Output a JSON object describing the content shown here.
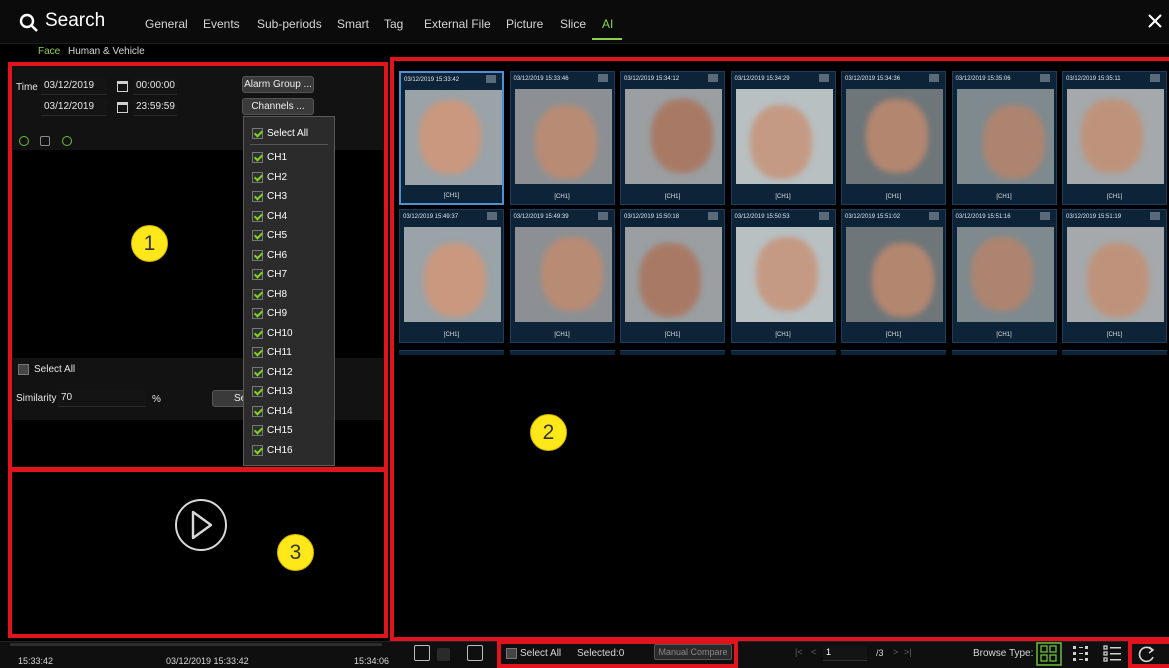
{
  "header": {
    "title": "Search",
    "tabs": [
      "General",
      "Events",
      "Sub-periods",
      "Smart",
      "Tag",
      "External File",
      "Picture",
      "Slice",
      "AI"
    ],
    "active_tab": "AI",
    "subtabs": [
      "Face",
      "Human & Vehicle"
    ],
    "active_subtab": "Face"
  },
  "filters": {
    "time_label": "Time",
    "start_date": "03/12/2019",
    "start_time": "00:00:00",
    "end_date": "03/12/2019",
    "end_time": "23:59:59",
    "alarm_group_btn": "Alarm Group ...",
    "channels_btn": "Channels ...",
    "select_all": "Select All",
    "similarity_label": "Similarity",
    "similarity_value": "70",
    "similarity_unit": "%",
    "search_btn_partial": "Se"
  },
  "channel_dropdown": {
    "select_all": "Select All",
    "channels": [
      "CH1",
      "CH2",
      "CH3",
      "CH4",
      "CH5",
      "CH6",
      "CH7",
      "CH8",
      "CH9",
      "CH10",
      "CH11",
      "CH12",
      "CH13",
      "CH14",
      "CH15",
      "CH16"
    ]
  },
  "badges": [
    "1",
    "2",
    "3"
  ],
  "results": [
    {
      "ts": "03/12/2019 15:33:42",
      "ch": "[CH1]"
    },
    {
      "ts": "03/12/2019 15:33:46",
      "ch": "[CH1]"
    },
    {
      "ts": "03/12/2019 15:34:12",
      "ch": "[CH1]"
    },
    {
      "ts": "03/12/2019 15:34:29",
      "ch": "[CH1]"
    },
    {
      "ts": "03/12/2019 15:34:36",
      "ch": "[CH1]"
    },
    {
      "ts": "03/12/2019 15:35:06",
      "ch": "[CH1]"
    },
    {
      "ts": "03/12/2019 15:35:11",
      "ch": "[CH1]"
    },
    {
      "ts": "03/12/2019 15:49:37",
      "ch": "[CH1]"
    },
    {
      "ts": "03/12/2019 15:49:39",
      "ch": "[CH1]"
    },
    {
      "ts": "03/12/2019 15:50:18",
      "ch": "[CH1]"
    },
    {
      "ts": "03/12/2019 15:50:53",
      "ch": "[CH1]"
    },
    {
      "ts": "03/12/2019 15:51:02",
      "ch": "[CH1]"
    },
    {
      "ts": "03/12/2019 15:51:16",
      "ch": "[CH1]"
    },
    {
      "ts": "03/12/2019 15:51:19",
      "ch": "[CH1]"
    }
  ],
  "playback": {
    "start_time": "15:33:42",
    "current": "03/12/2019 15:33:42",
    "end_time": "15:34:06"
  },
  "footer": {
    "select_all": "Select All",
    "selected": "Selected:0",
    "manual_compare": "Manual Compare",
    "page_current": "1",
    "page_total": "/3",
    "browse_type": "Browse Type:"
  },
  "colors": {
    "accent_green": "#8fd14f",
    "highlight_red": "#e0141c",
    "badge_yellow": "#ffe81a",
    "selected_blue": "#4e8fd6"
  }
}
